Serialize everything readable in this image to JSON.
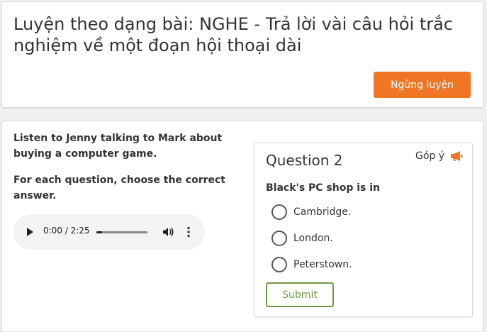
{
  "header": {
    "title": "Luyện theo dạng bài: NGHE - Trả lời vài câu hỏi trắc nghiệm về một đoạn hội thoại dài",
    "stop_label": "Ngừng luyện"
  },
  "instructions": {
    "line1": "Listen to Jenny talking to Mark about buying a computer game.",
    "line2": "For each question, choose the correct answer."
  },
  "audio": {
    "time": "0:00 / 2:25",
    "progress": 0.0
  },
  "question": {
    "title": "Question 2",
    "feedback_label": "Góp ý",
    "text": "Black's PC shop is in",
    "options": [
      "Cambridge.",
      "London.",
      "Peterstown."
    ],
    "submit_label": "Submit"
  },
  "colors": {
    "accent_orange": "#f07524",
    "submit_green": "#6b9a3c"
  },
  "icons": {
    "play": "play-icon",
    "volume": "volume-icon",
    "more": "more-vertical-icon",
    "feedback": "megaphone-icon"
  }
}
